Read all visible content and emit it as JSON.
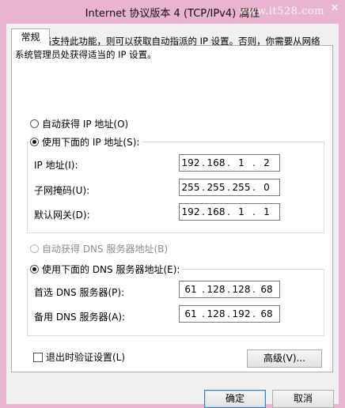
{
  "window": {
    "title": "Internet 协议版本 4 (TCP/IPv4) 属性",
    "watermark": "www.it528.com"
  },
  "tabs": [
    {
      "label": "常规"
    }
  ],
  "description": "如果网络支持此功能，则可以获取自动指派的 IP 设置。否则，你需要从网络系统管理员处获得适当的 IP 设置。",
  "ip_section": {
    "auto_option": "自动获得 IP 地址(O)",
    "manual_option": "使用下面的 IP 地址(S):",
    "selected": "manual",
    "fields": [
      {
        "label": "IP 地址(I):",
        "octets": [
          "192",
          "168",
          "1",
          "2"
        ]
      },
      {
        "label": "子网掩码(U):",
        "octets": [
          "255",
          "255",
          "255",
          "0"
        ]
      },
      {
        "label": "默认网关(D):",
        "octets": [
          "192",
          "168",
          "1",
          "1"
        ]
      }
    ]
  },
  "dns_section": {
    "auto_option": "自动获得 DNS 服务器地址(B)",
    "manual_option": "使用下面的 DNS 服务器地址(E):",
    "selected": "manual",
    "fields": [
      {
        "label": "首选 DNS 服务器(P):",
        "octets": [
          "61",
          "128",
          "128",
          "68"
        ]
      },
      {
        "label": "备用 DNS 服务器(A):",
        "octets": [
          "61",
          "128",
          "192",
          "68"
        ]
      }
    ]
  },
  "validate_checkbox": {
    "label": "退出时验证设置(L)",
    "checked": false
  },
  "buttons": {
    "advanced": "高级(V)...",
    "ok": "确定",
    "cancel": "取消"
  }
}
